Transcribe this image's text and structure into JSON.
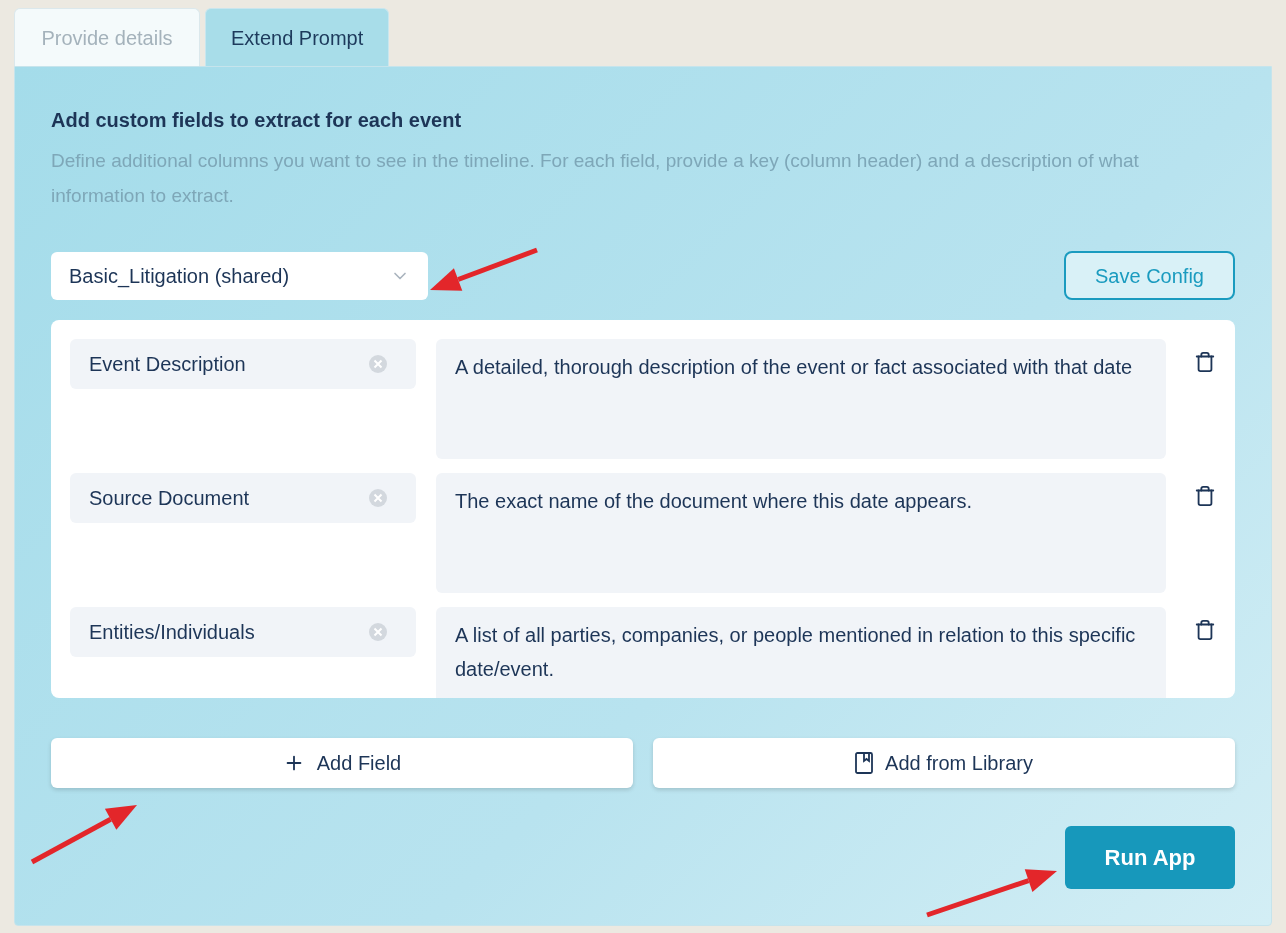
{
  "tabs": [
    {
      "label": "Provide details",
      "selected": false
    },
    {
      "label": "Extend Prompt",
      "selected": true
    }
  ],
  "heading": "Add custom fields to extract for each event",
  "description": "Define additional columns you want to see in the timeline. For each field, provide a key (column header) and a description of what information to extract.",
  "config_select": {
    "value": "Basic_Litigation (shared)"
  },
  "save_button": "Save Config",
  "fields": [
    {
      "key": "Event Description",
      "description": "A detailed, thorough description of the event or fact associated with that date"
    },
    {
      "key": "Source Document",
      "description": "The exact name of the document where this date appears."
    },
    {
      "key": "Entities/Individuals",
      "description": "A list of all parties, companies, or people mentioned in relation to this specific date/event."
    }
  ],
  "add_field_button": "Add Field",
  "add_library_button": "Add from Library",
  "run_button": "Run App"
}
